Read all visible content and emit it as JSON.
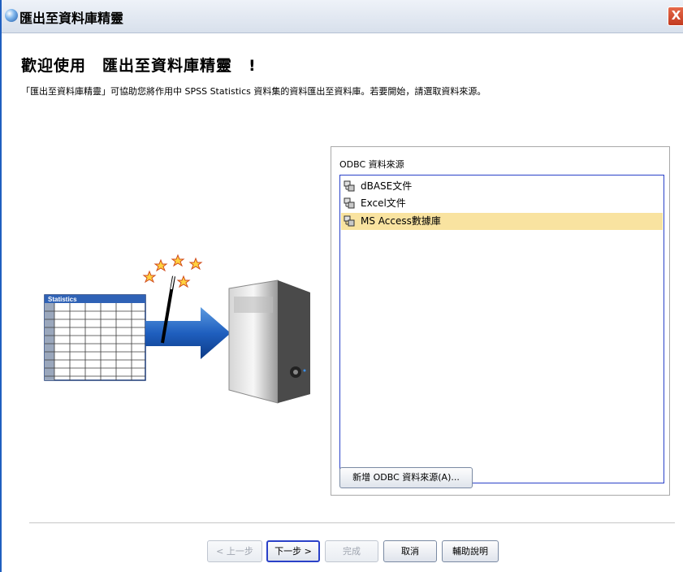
{
  "window": {
    "title": "匯出至資料庫精靈",
    "close_label": "X"
  },
  "heading": "歡迎使用　匯出至資料庫精靈　!",
  "description": "「匯出至資料庫精靈」可協助您將作用中 SPSS Statistics 資料集的資料匯出至資料庫。若要開始，請選取資料來源。",
  "illustration": {
    "table_title": "Statistics"
  },
  "odbc": {
    "label": "ODBC 資料來源",
    "items": [
      {
        "label": "dBASE文件",
        "icon": "database-source-icon",
        "selected": false
      },
      {
        "label": "Excel文件",
        "icon": "database-source-icon",
        "selected": false
      },
      {
        "label": "MS Access數據庫",
        "icon": "database-source-icon",
        "selected": true
      }
    ],
    "add_button": "新增 ODBC 資料來源(A)..."
  },
  "buttons": {
    "back": "< 上一步",
    "next": "下一步 >",
    "finish": "完成",
    "cancel": "取消",
    "help": "輔助說明"
  },
  "colors": {
    "selection": "#f9e3a0",
    "focus_border": "#2a41c8",
    "arrow": "#1f5fbf"
  }
}
